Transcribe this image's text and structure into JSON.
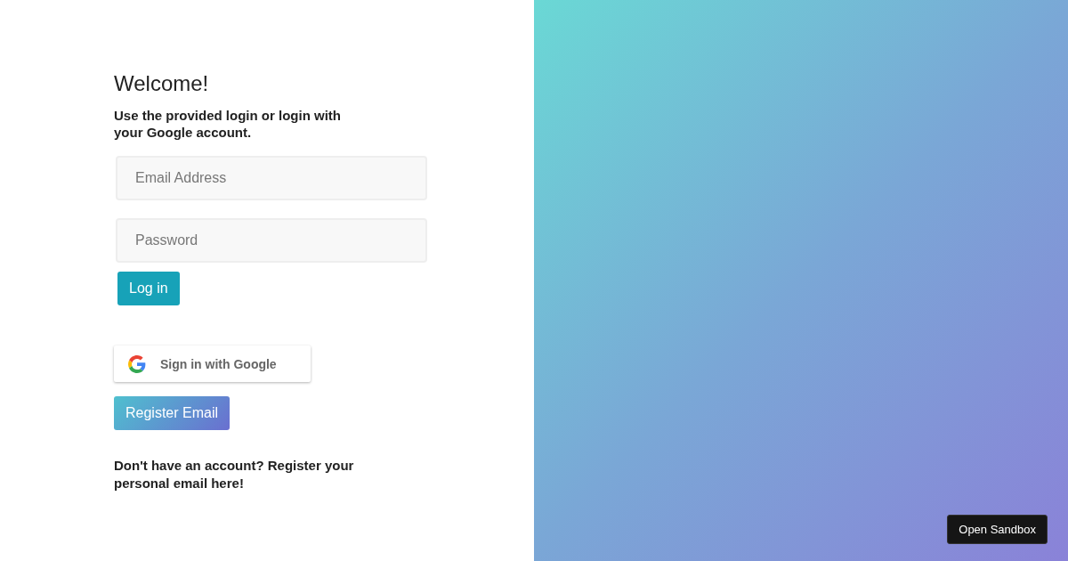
{
  "title": "Welcome!",
  "subtitle": "Use the provided login or login with your Google account.",
  "email_field": {
    "placeholder": "Email Address"
  },
  "password_field": {
    "placeholder": "Password"
  },
  "login_button": "Log in",
  "google_button": "Sign in with Google",
  "register_button": "Register Email",
  "register_note": "Don't have an account? Register your personal email here!",
  "sandbox_button": "Open Sandbox"
}
